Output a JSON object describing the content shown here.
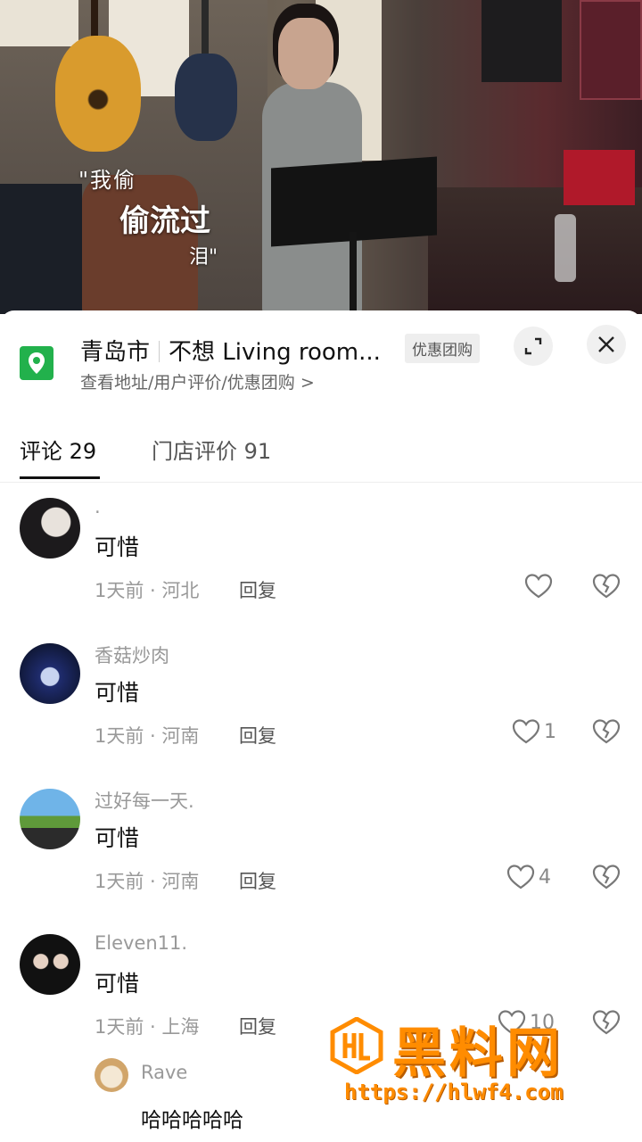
{
  "video": {
    "lyric_line1": "\"我偷",
    "lyric_line2": "偷流过",
    "lyric_line3": "泪\""
  },
  "location": {
    "city": "青岛市",
    "place": "不想 Living room...",
    "badge": "优惠团购",
    "subtitle": "查看地址/用户评价/优惠团购 >",
    "icon": "map-pin-icon",
    "accent": "#22b14c"
  },
  "tabs": [
    {
      "label": "评论 29"
    },
    {
      "label": "门店评价 91"
    }
  ],
  "comments": [
    {
      "name": ".",
      "text": "可惜",
      "meta": "1天前 · 河北",
      "reply": "回复",
      "likes": ""
    },
    {
      "name": "香菇炒肉",
      "text": "可惜",
      "meta": "1天前 · 河南",
      "reply": "回复",
      "likes": "1"
    },
    {
      "name": "过好每一天.",
      "text": "可惜",
      "meta": "1天前 · 河南",
      "reply": "回复",
      "likes": "4"
    },
    {
      "name": "Eleven11.",
      "text": "可惜",
      "meta": "1天前 · 上海",
      "reply": "回复",
      "likes": "10"
    }
  ],
  "sub_reply": {
    "name": "Rave",
    "text": "哈哈哈哈哈"
  },
  "watermark": {
    "title": "黑料网",
    "url": "https://hlwf4.com",
    "color": "#ff8c00"
  }
}
